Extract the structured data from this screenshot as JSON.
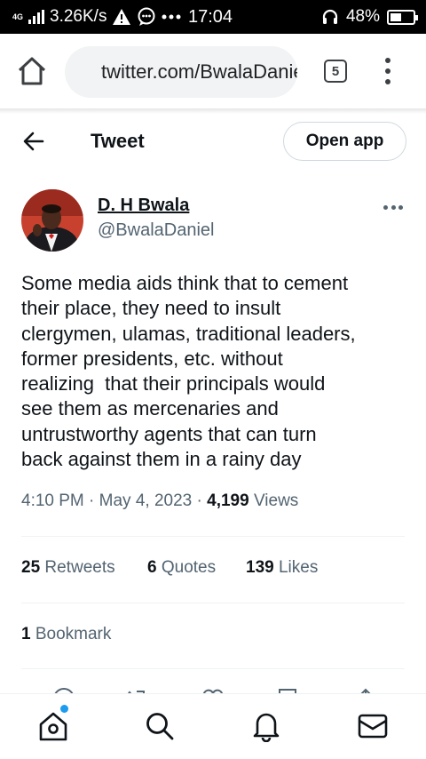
{
  "status_bar": {
    "network_type": "4G",
    "speed": "3.26K/s",
    "time": "17:04",
    "battery": "48%",
    "battery_level": 0.48
  },
  "browser": {
    "url": "twitter.com/BwalaDaniel/status",
    "tab_count": "5"
  },
  "header": {
    "title": "Tweet",
    "open_app_label": "Open app"
  },
  "tweet": {
    "author_name": "D. H Bwala",
    "author_handle": "@BwalaDaniel",
    "text_lines": [
      "Some media aids think that to cement",
      "their place, they need to insult",
      "clergymen, ulamas, traditional leaders,",
      "former presidents, etc. without",
      "realizing  that their principals would",
      "see them as mercenaries and",
      "untrustworthy agents that can turn",
      "back against them in a rainy day"
    ],
    "time": "4:10 PM",
    "date": "May 4, 2023",
    "views_count": "4,199",
    "views_label": "Views"
  },
  "stats": {
    "retweets_count": "25",
    "retweets_label": "Retweets",
    "quotes_count": "6",
    "quotes_label": "Quotes",
    "likes_count": "139",
    "likes_label": "Likes",
    "bookmarks_count": "1",
    "bookmarks_label": "Bookmark"
  },
  "colors": {
    "accent": "#1d9bf0",
    "secondary_text": "#536471",
    "primary_text": "#0f1419"
  }
}
